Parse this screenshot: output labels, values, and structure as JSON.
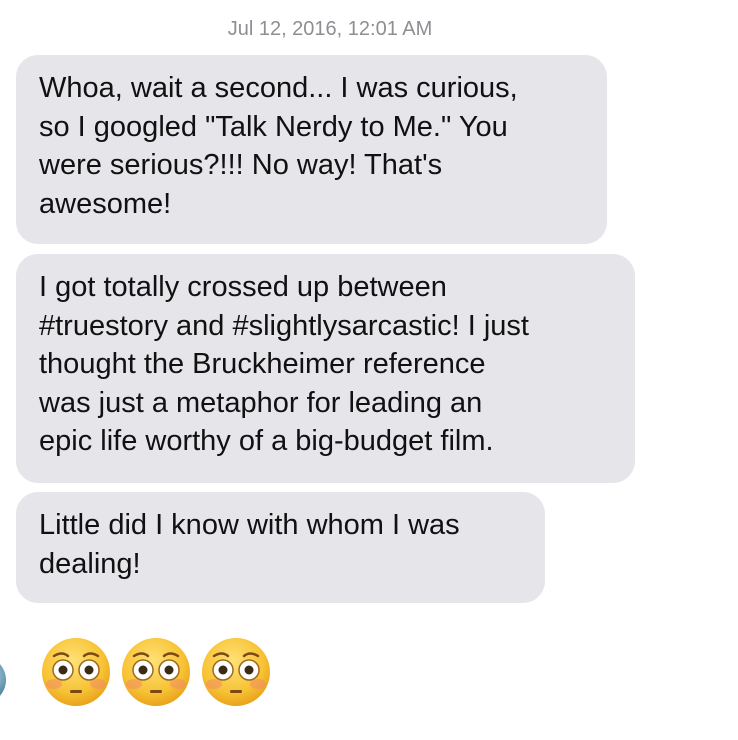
{
  "conversation": {
    "timestamp": "Jul 12, 2016, 12:01 AM",
    "messages": [
      {
        "text": "Whoa, wait a second... I was curious,\nso I googled \"Talk Nerdy to Me.\" You\nwere serious?!!! No way! That's\nawesome!"
      },
      {
        "text": "I got totally crossed up between\n#truestory and #slightlysarcastic! I just\nthought the Bruckheimer reference\nwas just a metaphor for leading an\nepic life worthy of a big-budget film."
      },
      {
        "text": "Little did I know with whom I was\ndealing!"
      }
    ],
    "emoji_message": {
      "emojis": [
        "flushed-face",
        "flushed-face",
        "flushed-face"
      ]
    }
  },
  "colors": {
    "incoming_bubble": "#e5e5ea",
    "timestamp_text": "#8e8e93",
    "message_text": "#111111"
  }
}
